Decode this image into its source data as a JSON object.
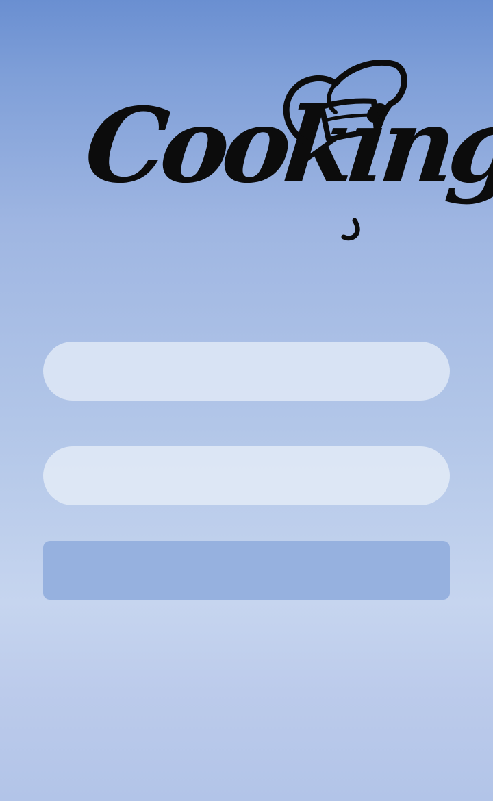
{
  "logo": {
    "text": "Cooking",
    "icon": "chef-hat-icon",
    "color": "#0c0c0c"
  },
  "form": {
    "field_1": {
      "value": "",
      "placeholder": ""
    },
    "field_2": {
      "value": "",
      "placeholder": ""
    },
    "submit_label": ""
  },
  "colors": {
    "background_top": "#6a8fd1",
    "background_bottom": "#c6d5ef",
    "input_fill": "#dde5f3",
    "button_fill": "#96b1df"
  }
}
